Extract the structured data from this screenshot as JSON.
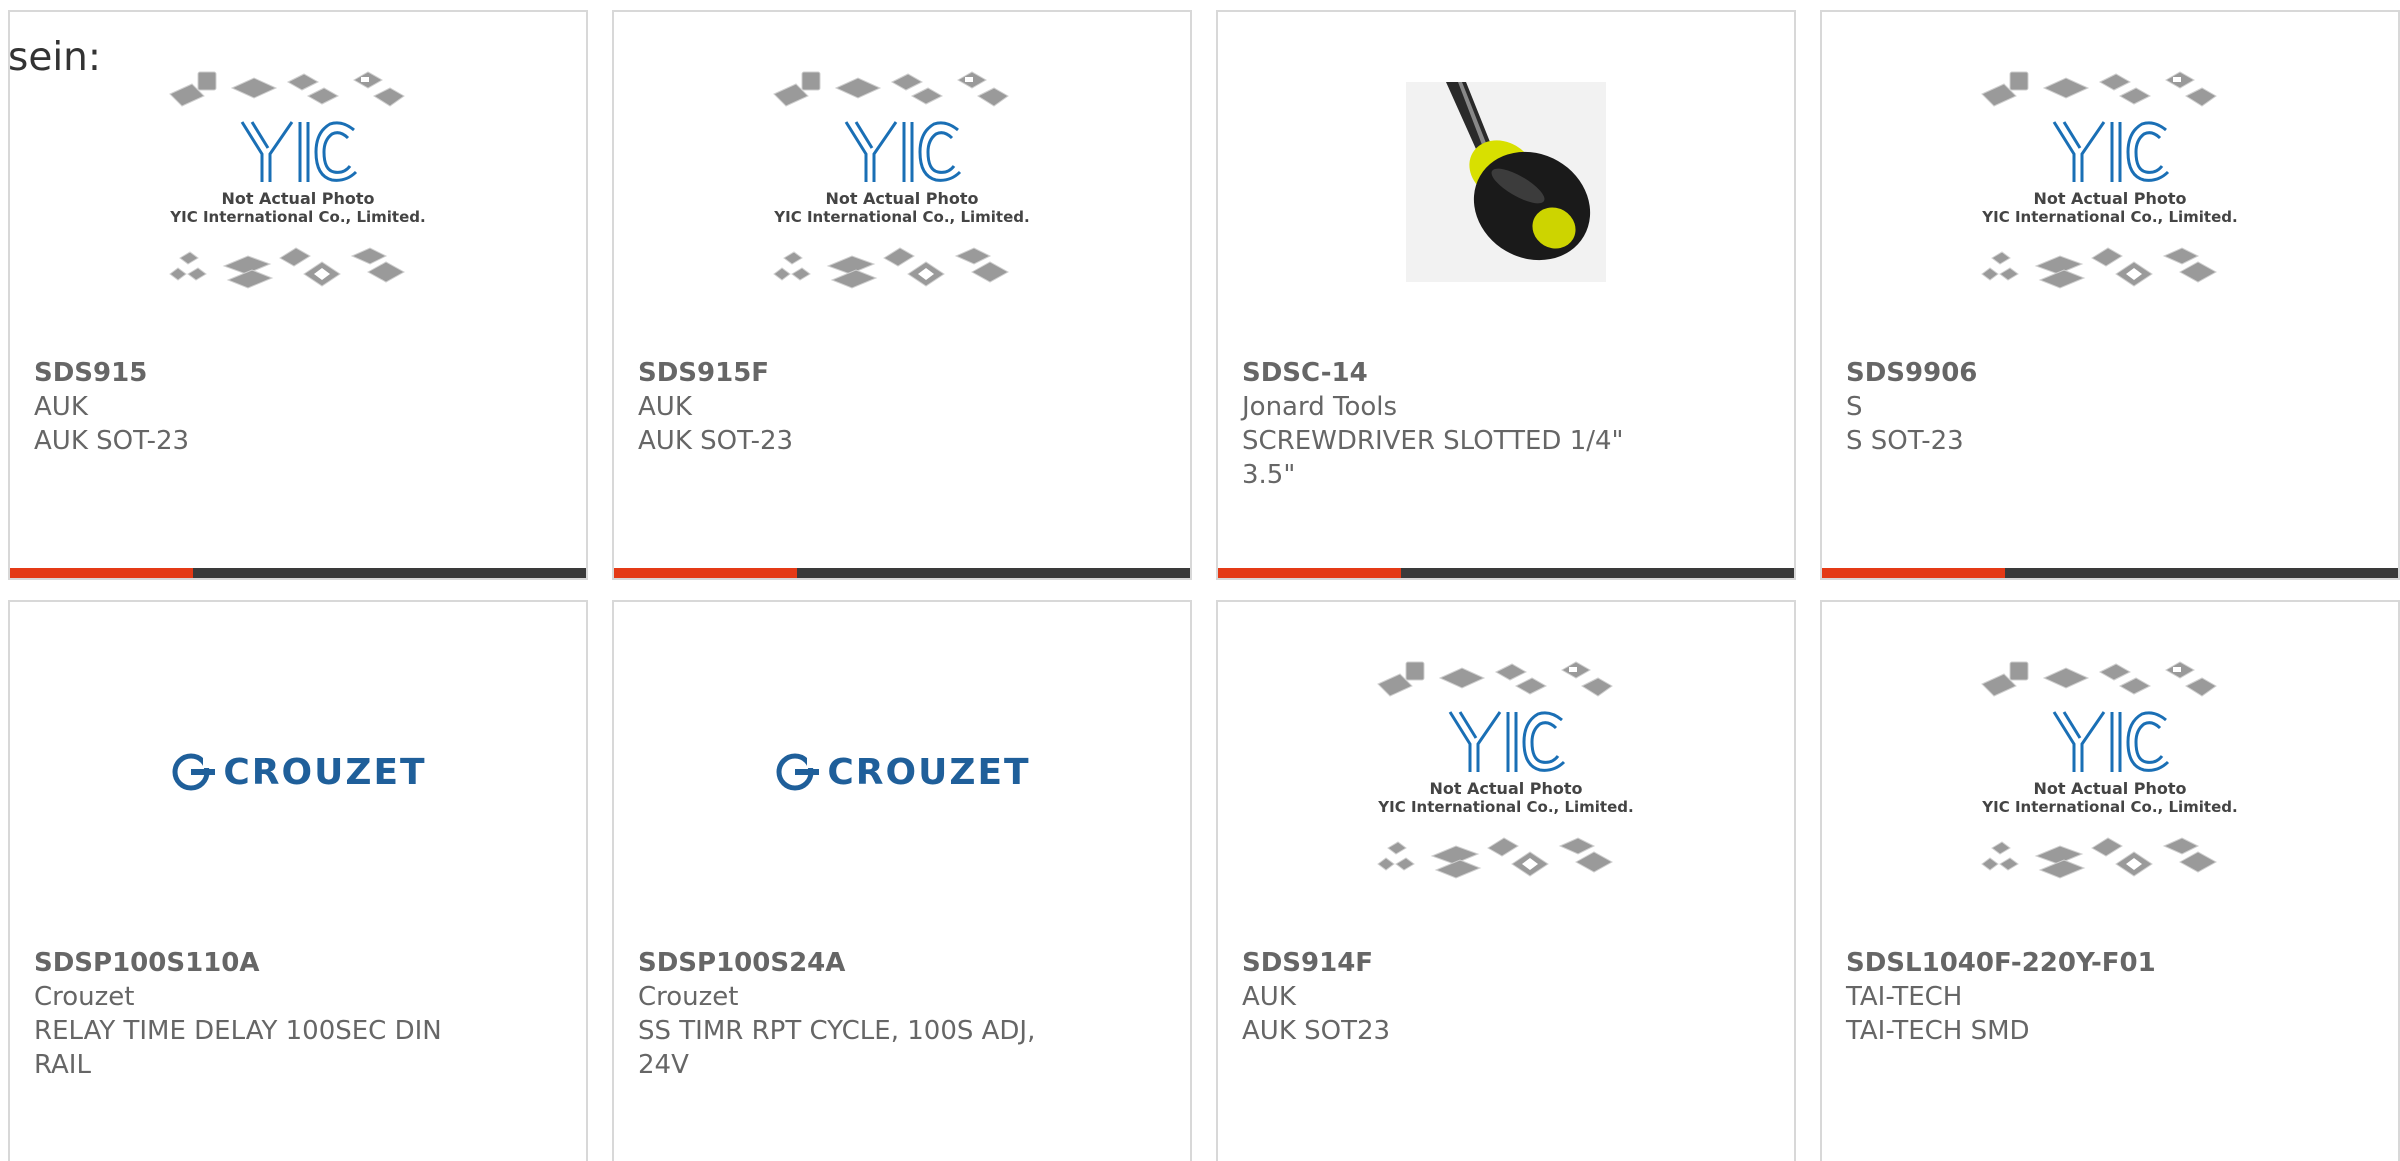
{
  "heading": "sein:",
  "colors": {
    "accent": "#e43a16",
    "bar": "#3a3a3a",
    "text": "#666666",
    "yic_blue": "#1a6fb5",
    "crouzet_blue": "#1f5f9a"
  },
  "yic_placeholder": {
    "line1": "Not Actual Photo",
    "line2": "YIC International Co., Limited.",
    "logo": "YIC"
  },
  "crouzet_logo": "CROUZET",
  "products": [
    {
      "part": "SDS915",
      "manufacturer": "AUK",
      "description": "AUK SOT-23",
      "image": "yic-placeholder"
    },
    {
      "part": "SDS915F",
      "manufacturer": "AUK",
      "description": "AUK SOT-23",
      "image": "yic-placeholder"
    },
    {
      "part": "SDSC-14",
      "manufacturer": "Jonard Tools",
      "description": "SCREWDRIVER SLOTTED 1/4\" 3.5\"",
      "image": "screwdriver-photo"
    },
    {
      "part": "SDS9906",
      "manufacturer": "S",
      "description": "S SOT-23",
      "image": "yic-placeholder"
    },
    {
      "part": "SDSP100S110A",
      "manufacturer": "Crouzet",
      "description": "RELAY TIME DELAY 100SEC DIN RAIL",
      "image": "crouzet-logo"
    },
    {
      "part": "SDSP100S24A",
      "manufacturer": "Crouzet",
      "description": "SS TIMR RPT CYCLE, 100S ADJ, 24V",
      "image": "crouzet-logo"
    },
    {
      "part": "SDS914F",
      "manufacturer": "AUK",
      "description": "AUK SOT23",
      "image": "yic-placeholder"
    },
    {
      "part": "SDSL1040F-220Y-F01",
      "manufacturer": "TAI-TECH",
      "description": "TAI-TECH SMD",
      "image": "yic-placeholder"
    }
  ]
}
